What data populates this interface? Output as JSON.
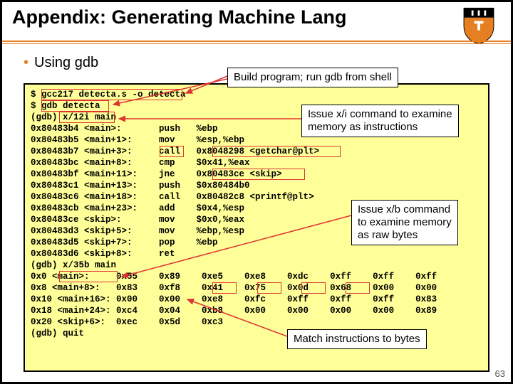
{
  "title": "Appendix: Generating Machine Lang",
  "bullet": "Using gdb",
  "annot": {
    "a1": "Build program; run gdb from shell",
    "a2_l1": "Issue x/i command to examine",
    "a2_l2": "memory as instructions",
    "a3_l1": "Issue x/b command",
    "a3_l2": "to examine memory",
    "a3_l3": "as raw bytes",
    "a4": "Match instructions to bytes"
  },
  "code": "$ gcc217 detecta.s -o detecta\n$ gdb detecta\n(gdb) x/12i main\n0x80483b4 <main>:       push   %ebp\n0x80483b5 <main+1>:     mov    %esp,%ebp\n0x80483b7 <main+3>:     call   0x8048298 <getchar@plt>\n0x80483bc <main+8>:     cmp    $0x41,%eax\n0x80483bf <main+11>:    jne    0x80483ce <skip>\n0x80483c1 <main+13>:    push   $0x80484b0\n0x80483c6 <main+18>:    call   0x80482c8 <printf@plt>\n0x80483cb <main+23>:    add    $0x4,%esp\n0x80483ce <skip>:       mov    $0x0,%eax\n0x80483d3 <skip+5>:     mov    %ebp,%esp\n0x80483d5 <skip+7>:     pop    %ebp\n0x80483d6 <skip+8>:     ret\n(gdb) x/35b main\n0x0 <main>:     0x55    0x89    0xe5    0xe8    0xdc    0xff    0xff    0xff\n0x8 <main+8>:   0x83    0xf8    0x41    0x75    0x0d    0x68    0x00    0x00\n0x10 <main+16>: 0x00    0x00    0xe8    0xfc    0xff    0xff    0xff    0x83\n0x18 <main+24>: 0xc4    0x04    0xb8    0x00    0x00    0x00    0x00    0x89\n0x20 <skip+6>:  0xec    0x5d    0xc3\n(gdb) quit",
  "pagenum": "63"
}
